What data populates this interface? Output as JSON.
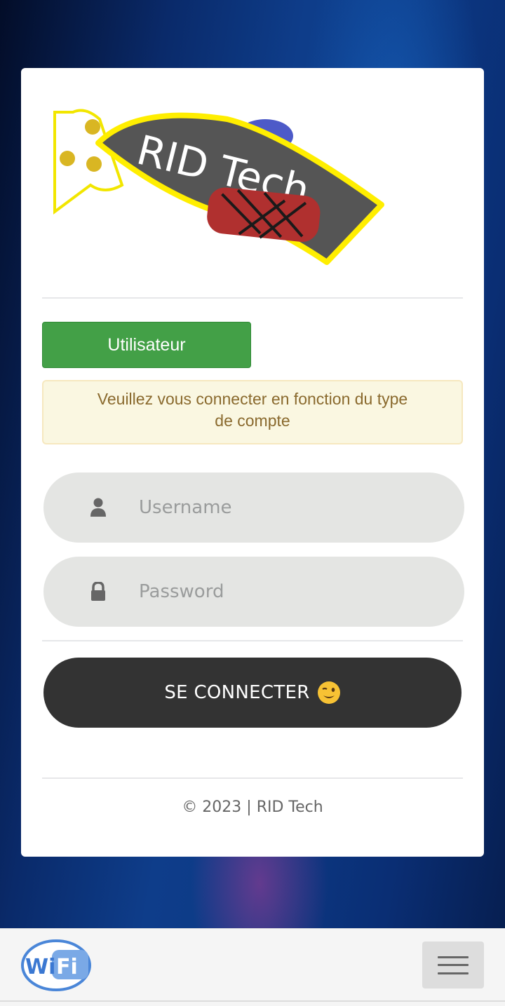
{
  "logo": {
    "text": "RID Tech"
  },
  "role_button": {
    "label": "Utilisateur"
  },
  "alert": {
    "message": "Veuillez vous connecter en fonction du type de compte"
  },
  "username": {
    "placeholder": "Username",
    "icon": "user-icon"
  },
  "password": {
    "placeholder": "Password",
    "icon": "lock-icon"
  },
  "submit": {
    "label": "SE CONNECTER",
    "emoji": "winking-face-icon"
  },
  "footer": {
    "text": "© 2023 | RID Tech"
  },
  "bottom_bar": {
    "brand": {
      "label": "Wi Fi",
      "icon": "wifi-logo"
    },
    "menu_icon": "hamburger-menu-icon"
  },
  "colors": {
    "accent_green": "#43a047",
    "button_dark": "#333333",
    "alert_bg": "#faf7e1",
    "alert_text": "#8a6a2e",
    "field_bg": "#e4e5e3"
  }
}
